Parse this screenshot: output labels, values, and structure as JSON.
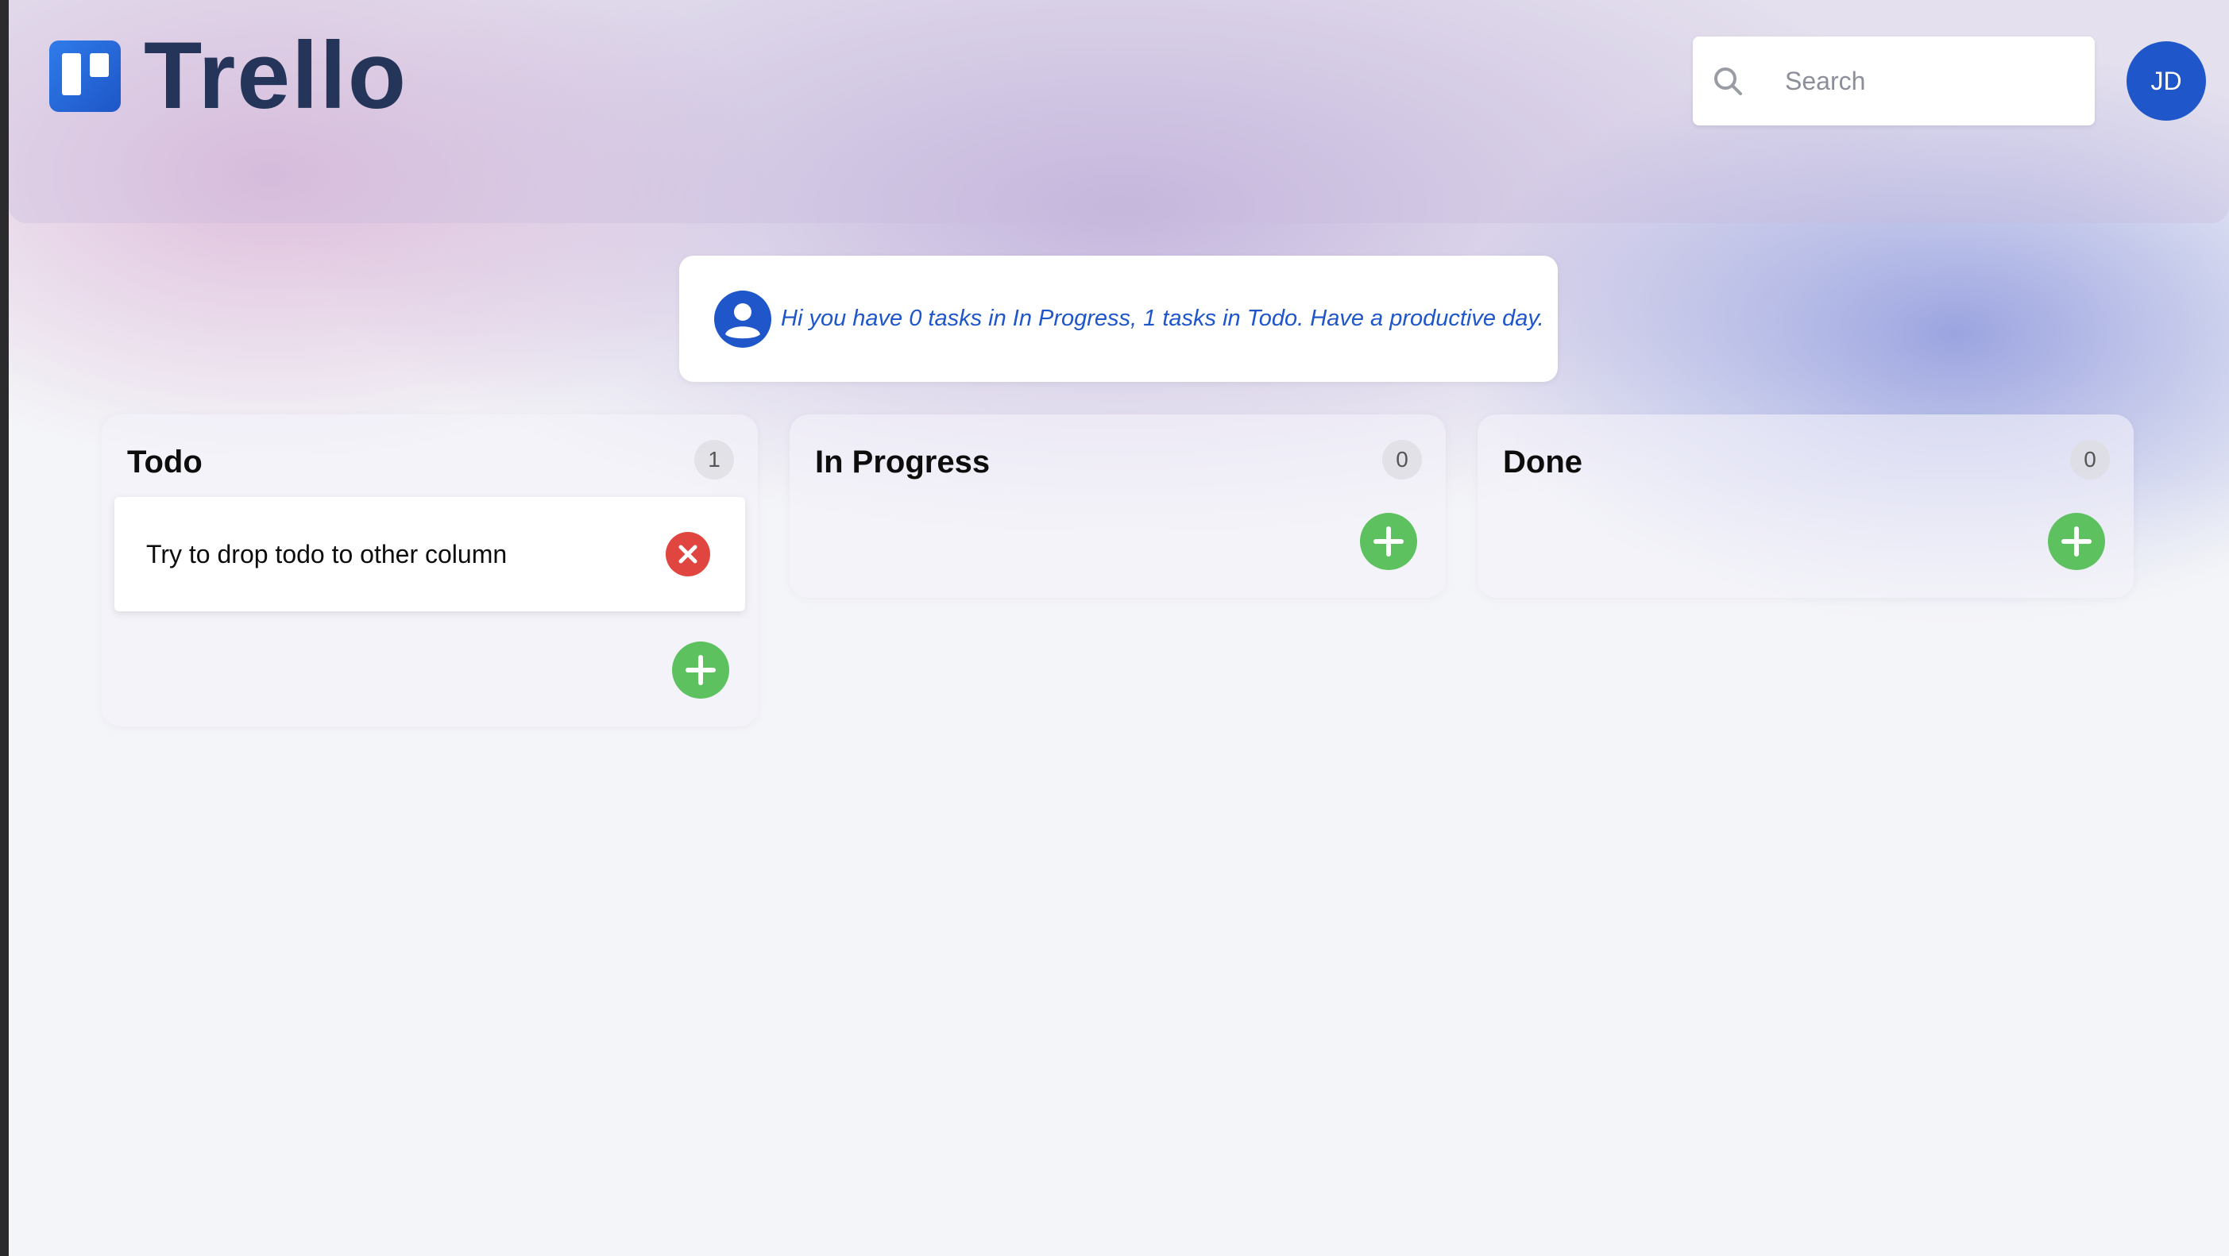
{
  "app": {
    "logo_text": "Trello",
    "logo_icon": "trello-board-icon",
    "brand_color": "#1f56c9"
  },
  "header": {
    "search": {
      "placeholder": "Search",
      "value": "",
      "icon": "search-icon"
    },
    "avatar": {
      "initials": "JD",
      "color": "#1f56c9"
    }
  },
  "greeting": {
    "icon": "user-circle-icon",
    "text": "Hi you have 0 tasks in In Progress, 1 tasks in Todo. Have a productive day."
  },
  "columns": [
    {
      "title": "Todo",
      "count": "1",
      "cards": [
        {
          "text": "Try to drop todo to other column",
          "delete_icon": "close-circle-icon"
        }
      ],
      "add_icon": "plus-circle-icon"
    },
    {
      "title": "In Progress",
      "count": "0",
      "cards": [],
      "add_icon": "plus-circle-icon"
    },
    {
      "title": "Done",
      "count": "0",
      "cards": [],
      "add_icon": "plus-circle-icon"
    }
  ],
  "colors": {
    "add_button": "#5cc15e",
    "delete_button": "#e1453f",
    "logo_text": "#25355a"
  }
}
